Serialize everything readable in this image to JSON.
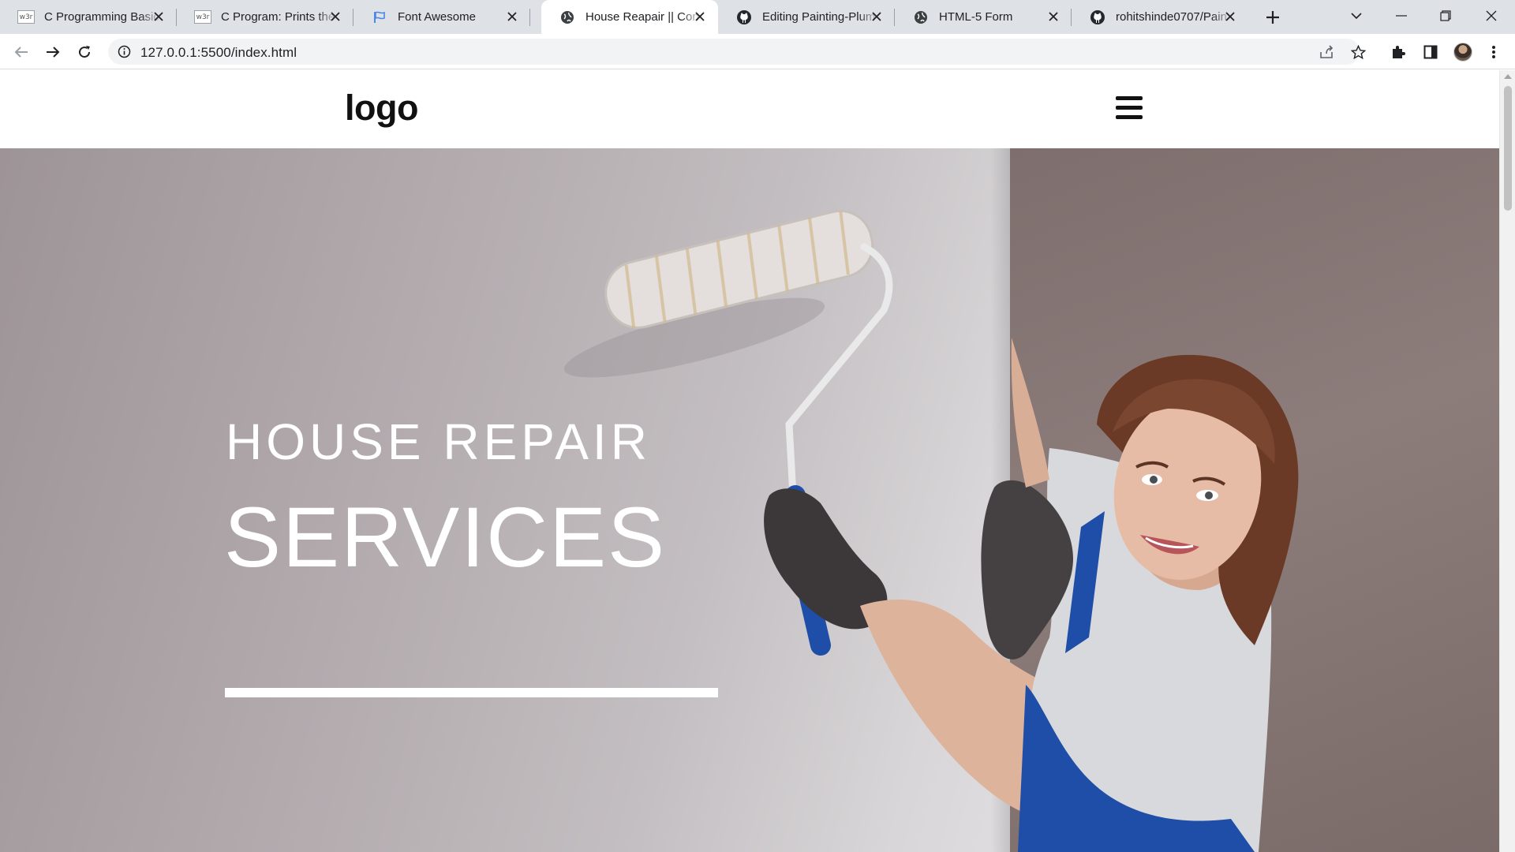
{
  "browser": {
    "tabs": [
      {
        "title": "C Programming Basic",
        "favicon": "w3schools-icon",
        "favicon_text": "w3r",
        "active": false
      },
      {
        "title": "C Program: Prints the",
        "favicon": "w3schools-icon",
        "favicon_text": "w3r",
        "active": false
      },
      {
        "title": "Font Awesome",
        "favicon": "flag-icon",
        "active": false
      },
      {
        "title": "House Reapair || Cons",
        "favicon": "globe-icon",
        "active": true
      },
      {
        "title": "Editing Painting-Plum",
        "favicon": "github-icon",
        "active": false
      },
      {
        "title": "HTML-5 Form",
        "favicon": "globe-icon",
        "active": false
      },
      {
        "title": "rohitshinde0707/Pain",
        "favicon": "github-icon",
        "active": false
      }
    ],
    "address_bar": {
      "url": "127.0.0.1:5500/index.html"
    },
    "colors": {
      "tabstrip": "#dee1e6",
      "active_tab": "#ffffff",
      "omnibox": "#f1f3f4"
    }
  },
  "page": {
    "header": {
      "logo_text": "logo",
      "menu_icon": "hamburger-menu-icon"
    },
    "hero": {
      "subtitle": "HOUSE REPAIR",
      "title": "SERVICES",
      "image": "woman-painter-with-paint-roller"
    }
  }
}
